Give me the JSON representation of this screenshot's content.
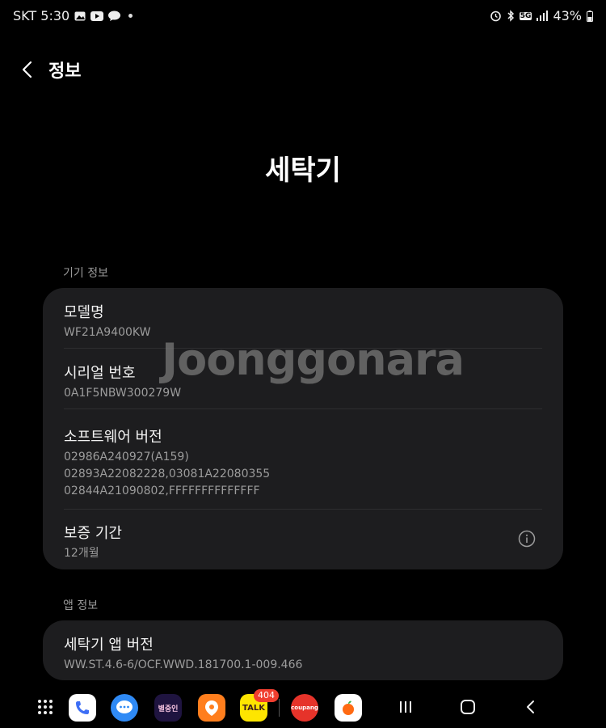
{
  "status_bar": {
    "carrier_time": "SKT 5:30",
    "network": "5G",
    "battery": "43%",
    "left_icons": [
      "gallery-icon",
      "youtube-icon",
      "talk-icon"
    ],
    "right_icons": [
      "alarm-icon",
      "bluetooth-icon",
      "5g-icon",
      "signal-icon",
      "battery-icon"
    ]
  },
  "app_bar": {
    "title": "정보"
  },
  "page_title": "세탁기",
  "watermark": "Joonggonara",
  "device_section": {
    "label": "기기 정보",
    "items": [
      {
        "title": "모델명",
        "lines": [
          "WF21A9400KW"
        ]
      },
      {
        "title": "시리얼 번호",
        "lines": [
          "0A1F5NBW300279W"
        ]
      },
      {
        "title": "소프트웨어 버전",
        "lines": [
          "02986A240927(A159)",
          "02893A22082228,03081A22080355",
          "02844A21090802,FFFFFFFFFFFFFF"
        ]
      },
      {
        "title": "보증 기간",
        "lines": [
          "12개월"
        ],
        "icon": "info-icon"
      }
    ]
  },
  "app_section": {
    "label": "앱 정보",
    "items": [
      {
        "title": "세탁기 앱 버전",
        "lines": [
          "WW.ST.4.6-6/OCF.WWD.181700.1-009.466"
        ]
      }
    ]
  },
  "nav_bar": {
    "apps": [
      {
        "name": "phone-app",
        "icon": "phone-icon"
      },
      {
        "name": "messages-app",
        "icon": "messages-icon"
      },
      {
        "name": "game-app",
        "label": "별중인"
      },
      {
        "name": "daangn-app",
        "icon": "carrot-icon"
      },
      {
        "name": "kakaotalk-app",
        "label": "TALK",
        "badge": "404"
      },
      {
        "name": "coupang-app",
        "label": "coupang"
      },
      {
        "name": "orange-app",
        "icon": "fruit-icon"
      }
    ],
    "buttons": [
      "recents-button",
      "home-button",
      "back-button"
    ]
  }
}
